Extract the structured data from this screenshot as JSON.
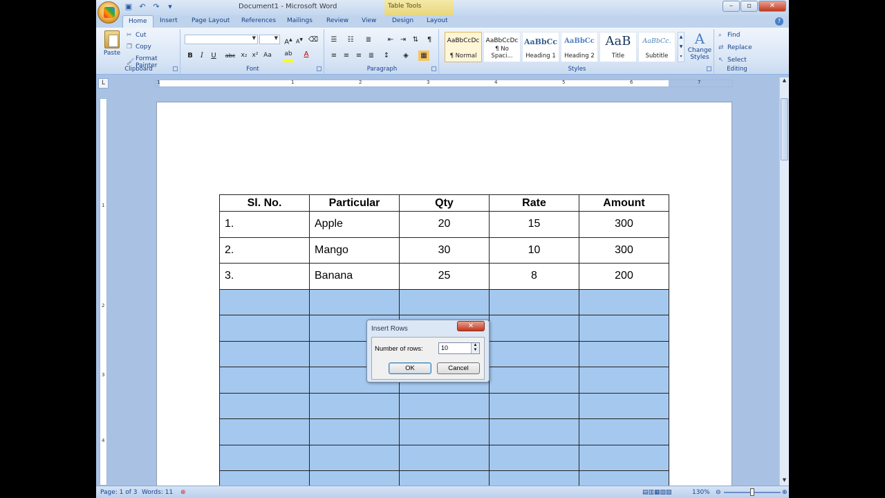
{
  "titlebar": {
    "document_title": "Document1 - Microsoft Word",
    "contextual_tab": "Table Tools",
    "minimize": "–",
    "maximize": "▫",
    "close": "✕"
  },
  "tabs": [
    "Home",
    "Insert",
    "Page Layout",
    "References",
    "Mailings",
    "Review",
    "View",
    "Design",
    "Layout"
  ],
  "ribbon": {
    "clipboard": {
      "paste": "Paste",
      "cut": "Cut",
      "copy": "Copy",
      "format_painter": "Format Painter",
      "label": "Clipboard"
    },
    "font": {
      "label": "Font"
    },
    "paragraph": {
      "label": "Paragraph"
    },
    "styles": {
      "label": "Styles",
      "items": [
        {
          "sample": "AaBbCcDc",
          "name": "¶ Normal"
        },
        {
          "sample": "AaBbCcDc",
          "name": "¶ No Spaci..."
        },
        {
          "sample": "AaBbCc",
          "name": "Heading 1"
        },
        {
          "sample": "AaBbCc",
          "name": "Heading 2"
        },
        {
          "sample": "AaB",
          "name": "Title"
        },
        {
          "sample": "AaBbCc.",
          "name": "Subtitle"
        }
      ],
      "change_styles_line1": "Change",
      "change_styles_line2": "Styles"
    },
    "editing": {
      "find": "Find",
      "replace": "Replace",
      "select": "Select",
      "label": "Editing"
    }
  },
  "ruler": {
    "h_numbers": [
      "1",
      "1",
      "2",
      "3",
      "4",
      "5",
      "6",
      "7"
    ],
    "v_numbers": [
      "1",
      "2",
      "3",
      "4"
    ]
  },
  "table": {
    "headers": [
      "Sl. No.",
      "Particular",
      "Qty",
      "Rate",
      "Amount"
    ],
    "rows": [
      [
        "1.",
        "Apple",
        "20",
        "15",
        "300"
      ],
      [
        "2.",
        "Mango",
        "30",
        "10",
        "300"
      ],
      [
        "3.",
        "Banana",
        "25",
        "8",
        "200"
      ]
    ],
    "selected_empty_rows": 8
  },
  "dialog": {
    "title": "Insert Rows",
    "close": "✕",
    "label": "Number of rows:",
    "value": "10",
    "ok": "OK",
    "cancel": "Cancel"
  },
  "status": {
    "page": "Page: 1 of 3",
    "words": "Words: 11",
    "zoom": "130%"
  }
}
